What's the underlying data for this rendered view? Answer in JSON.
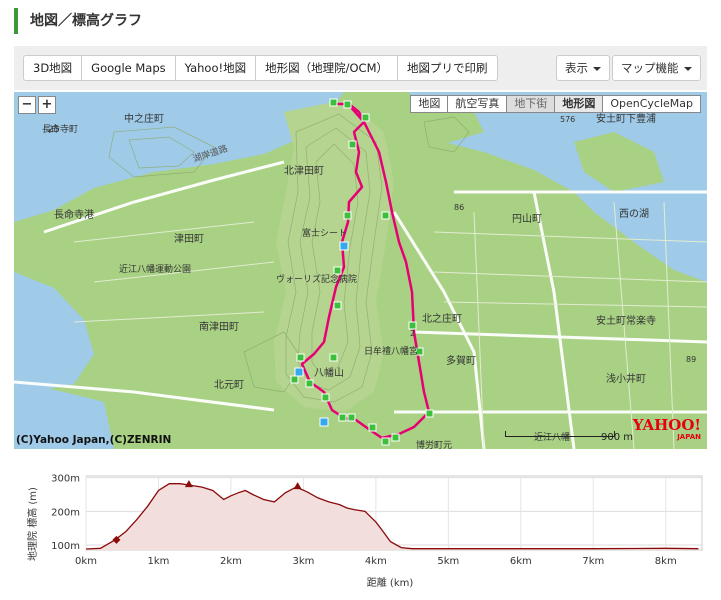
{
  "page": {
    "title": "地図／標高グラフ"
  },
  "toolbar": {
    "buttons": [
      "3D地図",
      "Google Maps",
      "Yahoo!地図",
      "地形図（地理院/OCM）",
      "地図プリで印刷"
    ],
    "display_label": "表示",
    "map_features_label": "マップ機能"
  },
  "map": {
    "zoom_out": "−",
    "zoom_in": "+",
    "types": [
      "地図",
      "航空写真",
      "地下街",
      "地形図",
      "OpenCycleMap"
    ],
    "active_type": "地形図",
    "copyright": "(C)Yahoo Japan,(C)ZENRIN",
    "scale_label": "900 m",
    "logo_text": "YAHOO!",
    "logo_sub": "JAPAN",
    "place_labels": [
      "中之庄町",
      "長命寺町",
      "長命寺港",
      "北津田町",
      "津田町",
      "近江八幡運動公園",
      "富士シート",
      "ヴォーリズ記念病院",
      "南津田町",
      "八幡山",
      "北之庄町",
      "安土町下豊浦",
      "円山町",
      "西の湖",
      "安土町常楽寺",
      "浅小井町",
      "北元町",
      "日牟禮八幡宮",
      "多賀町",
      "博労町元",
      "近江八幡",
      "湖岸道路"
    ],
    "road_numbers": [
      "25",
      "576",
      "2"
    ],
    "elevation_marks": [
      "86",
      "89"
    ]
  },
  "elevation": {
    "ylabel": "地理院 標高 (m)",
    "xlabel": "距離 (km)"
  },
  "chart_data": {
    "type": "area",
    "xlabel": "距離 (km)",
    "ylabel": "地理院 標高 (m)",
    "ylim": [
      85,
      305
    ],
    "xlim": [
      0,
      8.5
    ],
    "yticks": [
      "100m",
      "200m",
      "300m"
    ],
    "xticks": [
      "0km",
      "1km",
      "2km",
      "3km",
      "4km",
      "5km",
      "6km",
      "7km",
      "8km"
    ],
    "x": [
      0,
      0.2,
      0.4,
      0.55,
      0.7,
      0.85,
      1.0,
      1.15,
      1.3,
      1.45,
      1.6,
      1.75,
      1.9,
      2.0,
      2.1,
      2.2,
      2.3,
      2.45,
      2.6,
      2.75,
      2.9,
      3.05,
      3.2,
      3.35,
      3.5,
      3.6,
      3.7,
      3.85,
      4.0,
      4.1,
      4.2,
      4.35,
      4.5,
      5,
      6,
      7,
      8,
      8.45
    ],
    "y": [
      88,
      90,
      115,
      140,
      175,
      215,
      262,
      282,
      282,
      277,
      272,
      262,
      235,
      246,
      255,
      262,
      250,
      235,
      228,
      255,
      272,
      258,
      240,
      228,
      220,
      210,
      205,
      200,
      168,
      140,
      110,
      92,
      89,
      89,
      89,
      89,
      90,
      89
    ],
    "markers": [
      {
        "x": 0.42,
        "y": 115
      },
      {
        "x": 1.42,
        "y": 278
      },
      {
        "x": 2.92,
        "y": 272
      }
    ],
    "color": "#8b0a0a"
  }
}
